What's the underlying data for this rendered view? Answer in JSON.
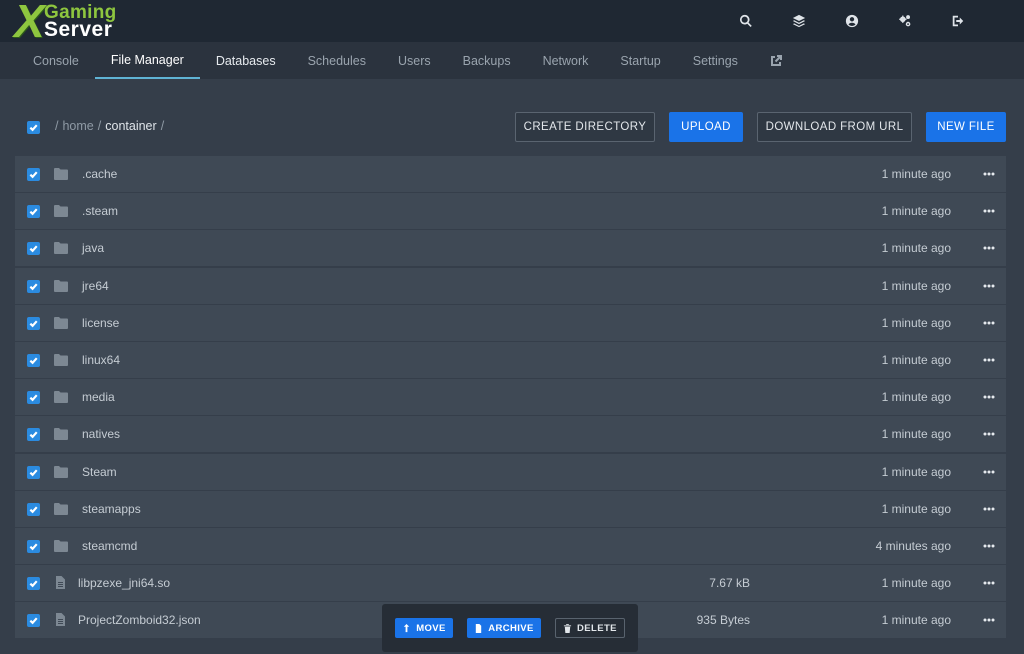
{
  "brand": {
    "logo_mark": "X",
    "logo_top": "Gaming",
    "logo_bottom": "Server",
    "accent_color": "#8ec63f"
  },
  "top_icons": [
    "search-icon",
    "layers-icon",
    "user-icon",
    "cogs-icon",
    "sign-out-icon"
  ],
  "nav": {
    "tabs": [
      "Console",
      "File Manager",
      "Databases",
      "Schedules",
      "Users",
      "Backups",
      "Network",
      "Startup",
      "Settings"
    ],
    "active": "File Manager",
    "external_icon": "external-link-icon"
  },
  "breadcrumb": {
    "sep": "/",
    "parts": [
      "home",
      "container"
    ]
  },
  "toolbar": {
    "create_directory": "CREATE DIRECTORY",
    "upload": "UPLOAD",
    "download_from_url": "DOWNLOAD FROM URL",
    "new_file": "NEW FILE",
    "primary_color": "#1a73e8"
  },
  "files": [
    {
      "name": ".cache",
      "type": "folder",
      "size": "",
      "modified": "1 minute ago"
    },
    {
      "name": ".steam",
      "type": "folder",
      "size": "",
      "modified": "1 minute ago"
    },
    {
      "name": "java",
      "type": "folder",
      "size": "",
      "modified": "1 minute ago"
    },
    {
      "name": "jre64",
      "type": "folder",
      "size": "",
      "modified": "1 minute ago"
    },
    {
      "name": "license",
      "type": "folder",
      "size": "",
      "modified": "1 minute ago"
    },
    {
      "name": "linux64",
      "type": "folder",
      "size": "",
      "modified": "1 minute ago"
    },
    {
      "name": "media",
      "type": "folder",
      "size": "",
      "modified": "1 minute ago"
    },
    {
      "name": "natives",
      "type": "folder",
      "size": "",
      "modified": "1 minute ago"
    },
    {
      "name": "Steam",
      "type": "folder",
      "size": "",
      "modified": "1 minute ago"
    },
    {
      "name": "steamapps",
      "type": "folder",
      "size": "",
      "modified": "1 minute ago"
    },
    {
      "name": "steamcmd",
      "type": "folder",
      "size": "",
      "modified": "4 minutes ago"
    },
    {
      "name": "libpzexe_jni64.so",
      "type": "file",
      "size": "7.67 kB",
      "modified": "1 minute ago"
    },
    {
      "name": "ProjectZomboid32.json",
      "type": "file",
      "size": "935 Bytes",
      "modified": "1 minute ago"
    }
  ],
  "bulk_actions": {
    "move": "MOVE",
    "archive": "ARCHIVE",
    "delete": "DELETE"
  }
}
